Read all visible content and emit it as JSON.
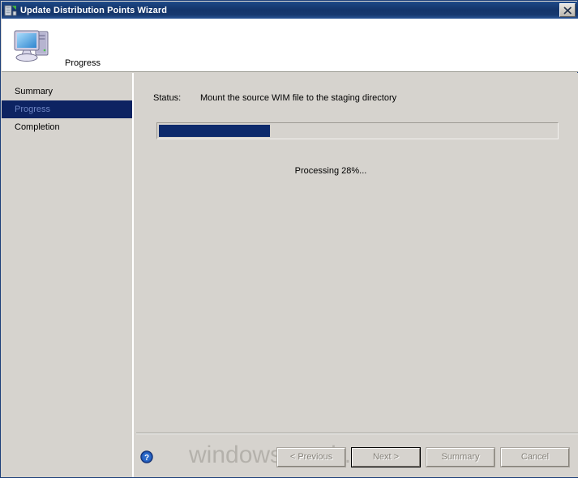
{
  "background": {
    "window_strip_present": true,
    "mini_button_glyph": "v"
  },
  "titlebar": {
    "title": "Update Distribution Points Wizard",
    "icon": "wizard-computer-icon",
    "close_label": "Close"
  },
  "header": {
    "title": "Progress",
    "icon": "computer-icon"
  },
  "sidebar": {
    "items": [
      {
        "label": "Summary",
        "selected": false
      },
      {
        "label": "Progress",
        "selected": true
      },
      {
        "label": "Completion",
        "selected": false
      }
    ]
  },
  "content": {
    "status_label": "Status:",
    "status_value": "Mount the source WIM file to the staging directory",
    "progress_percent": 28,
    "progress_caption": "Processing 28%...",
    "progress_fill_color": "#0d2a6c",
    "progress_track_color": "#d6d3ce"
  },
  "footer": {
    "help_icon": "help-question-icon",
    "watermark": "windows-noob.com",
    "buttons": [
      {
        "label": "< Previous",
        "enabled": false,
        "default": false
      },
      {
        "label": "Next >",
        "enabled": false,
        "default": true
      },
      {
        "label": "Summary",
        "enabled": false,
        "default": false
      },
      {
        "label": "Cancel",
        "enabled": false,
        "default": false
      }
    ]
  },
  "colors": {
    "dialog_face": "#d6d3ce",
    "titlebar_blue": "#14356b",
    "selection_navy": "#0d2362",
    "accent_blue": "#0d2a6c"
  }
}
